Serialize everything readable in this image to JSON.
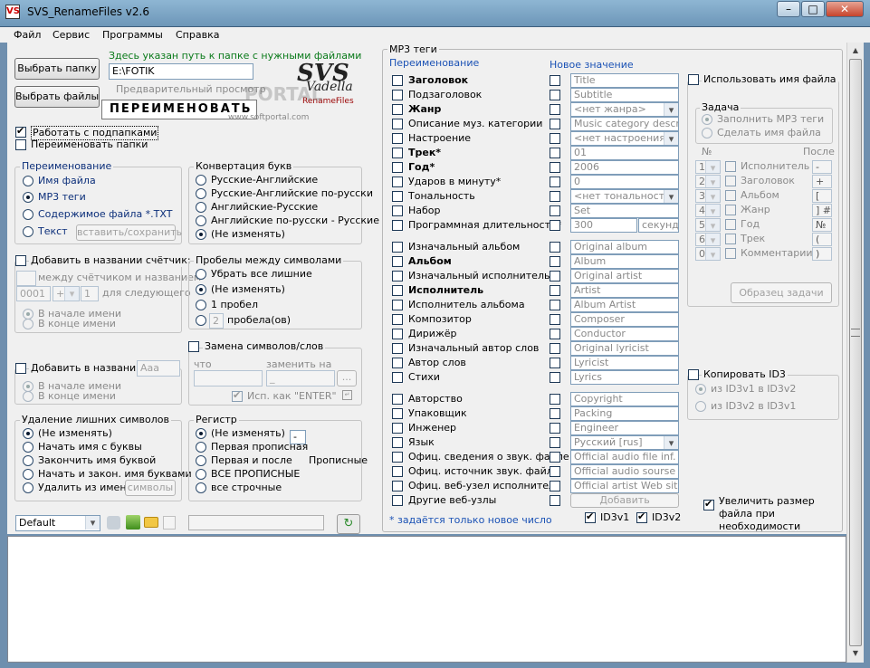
{
  "window": {
    "title": "SVS_RenameFiles v2.6",
    "icon": "app-icon",
    "controls": [
      "minimize-icon",
      "maximize-icon",
      "close-icon"
    ]
  },
  "menu": [
    "Файл",
    "Сервис",
    "Программы",
    "Справка"
  ],
  "left": {
    "select_folder": "Выбрать папку",
    "select_files": "Выбрать файлы",
    "path_hint": "Здесь указан путь к папке с нужными файлами",
    "path_value": "E:\\FOTIK",
    "preview_label": "Предварительный просмотр",
    "rename_button": "ПЕРЕИМЕНОВАТЬ",
    "logo_text": "SVS",
    "logo_sub": "Vadella",
    "logo_tag": "RenameFiles",
    "watermark": "PORTAL",
    "watermark_url": "www.softportal.com",
    "work_subfolders": "Работать с подпапками",
    "rename_folders": "Переименовать папки"
  },
  "rename_group": {
    "title": "Переименование",
    "items": [
      "Имя файла",
      "MP3 теги",
      "Содержимое файла *.TXT",
      "Текст"
    ],
    "insert_save": "вставить/сохранить"
  },
  "convert_group": {
    "title": "Конвертация букв",
    "items": [
      "Русские-Английские",
      "Русские-Английские по-русски",
      "Английские-Русские",
      "Английские по-русски - Русские",
      "(Не изменять)"
    ]
  },
  "counter_group": {
    "title": "Добавить в названии счётчик:",
    "between": "между счётчиком и названием",
    "start": "0001",
    "plus": "+",
    "step": "1",
    "next": "для следующего",
    "at_start": "В начале имени",
    "at_end": "В конце имени"
  },
  "spaces_group": {
    "title": "Пробелы между символами",
    "items": [
      "Убрать все лишние",
      "(Не изменять)",
      "1 пробел"
    ],
    "n_value": "2",
    "n_label": "пробела(ов)"
  },
  "replace_group": {
    "title": "Замена символов/слов",
    "what": "что",
    "replace_to": "заменить на",
    "replace_value": "_",
    "browse": "...",
    "as_enter": "Исп. как \"ENTER\""
  },
  "add_group": {
    "title": "Добавить в названии:",
    "value": "Aaa",
    "at_start": "В начале имени",
    "at_end": "В конце имени"
  },
  "remove_group": {
    "title": "Удаление лишних символов",
    "items": [
      "(Не изменять)",
      "Начать имя с буквы",
      "Закончить имя буквой",
      "Начать и закон. имя буквами",
      "Удалить из имени"
    ],
    "symbols_btn": "символы"
  },
  "case_group": {
    "title": "Регистр",
    "items": [
      "(Не изменять)",
      "Первая прописная",
      "Первая и после",
      "ВСЕ ПРОПИСНЫЕ",
      "все строчные"
    ],
    "after_value": "-",
    "upper_label": "Прописные"
  },
  "bottom_bar": {
    "preset": "Default"
  },
  "mp3": {
    "title": "MP3 теги",
    "rename_header": "Переименование",
    "new_value_header": "Новое значение",
    "rows": [
      {
        "label": "Заголовок",
        "bold": true,
        "value": "Title",
        "kind": "text"
      },
      {
        "label": "Подзаголовок",
        "bold": false,
        "value": "Subtitle",
        "kind": "text"
      },
      {
        "label": "Жанр",
        "bold": true,
        "value": "<нет жанра>",
        "kind": "dropdown"
      },
      {
        "label": "Описание муз. категории",
        "bold": false,
        "value": "Music category descripti",
        "kind": "text"
      },
      {
        "label": "Настроение",
        "bold": false,
        "value": "<нет настроения>",
        "kind": "dropdown"
      },
      {
        "label": "Трек*",
        "bold": true,
        "value": "01",
        "kind": "text"
      },
      {
        "label": "Год*",
        "bold": true,
        "value": "2006",
        "kind": "text"
      },
      {
        "label": "Ударов в минуту*",
        "bold": false,
        "value": "0",
        "kind": "text"
      },
      {
        "label": "Тональность",
        "bold": false,
        "value": "<нет тональности>",
        "kind": "dropdown"
      },
      {
        "label": "Набор",
        "bold": false,
        "value": "Set",
        "kind": "text"
      },
      {
        "label": "Программная длительность*",
        "bold": false,
        "value": "300",
        "kind": "duration"
      },
      {
        "label": "Изначальный альбом",
        "bold": false,
        "value": "Original album",
        "kind": "text"
      },
      {
        "label": "Альбом",
        "bold": true,
        "value": "Album",
        "kind": "text"
      },
      {
        "label": "Изначальный исполнитель",
        "bold": false,
        "value": "Original artist",
        "kind": "text"
      },
      {
        "label": "Исполнитель",
        "bold": true,
        "value": "Artist",
        "kind": "text"
      },
      {
        "label": "Исполнитель альбома",
        "bold": false,
        "value": "Album Artist",
        "kind": "text"
      },
      {
        "label": "Композитор",
        "bold": false,
        "value": "Composer",
        "kind": "text"
      },
      {
        "label": "Дирижёр",
        "bold": false,
        "value": "Conductor",
        "kind": "text"
      },
      {
        "label": "Изначальный автор слов",
        "bold": false,
        "value": "Original lyricist",
        "kind": "text"
      },
      {
        "label": "Автор слов",
        "bold": false,
        "value": "Lyricist",
        "kind": "text"
      },
      {
        "label": "Стихи",
        "bold": false,
        "value": "Lyrics",
        "kind": "text"
      },
      {
        "label": "Авторство",
        "bold": false,
        "value": "Copyright",
        "kind": "text"
      },
      {
        "label": "Упаковщик",
        "bold": false,
        "value": "Packing",
        "kind": "text"
      },
      {
        "label": "Инженер",
        "bold": false,
        "value": "Engineer",
        "kind": "text"
      },
      {
        "label": "Язык",
        "bold": false,
        "value": "Русский [rus]",
        "kind": "dropdown"
      },
      {
        "label": "Офиц. сведения о звук. файле",
        "bold": false,
        "value": "Official audio file inf.",
        "kind": "text"
      },
      {
        "label": "Офиц. источник звук. файла",
        "bold": false,
        "value": "Official audio sourse",
        "kind": "text"
      },
      {
        "label": "Офиц. веб-узел исполнителя",
        "bold": false,
        "value": "Official artist Web site",
        "kind": "text"
      },
      {
        "label": "Другие веб-узлы",
        "bold": false,
        "value": "",
        "kind": "add"
      }
    ],
    "seconds": "секунд",
    "add_button": "Добавить",
    "footnote": "* задаётся только новое число",
    "id3v1": "ID3v1",
    "id3v2": "ID3v2"
  },
  "filename_panel": {
    "use_filename": "Использовать имя файла",
    "task": "Задача",
    "fill_tags": "Заполнить MP3 теги",
    "make_name": "Сделать имя файла",
    "num_label": "№",
    "after_label": "После",
    "rows": [
      {
        "num": "1",
        "label": "Исполнитель",
        "after": "-"
      },
      {
        "num": "2",
        "label": "Заголовок",
        "after": "+"
      },
      {
        "num": "3",
        "label": "Альбом",
        "after": "["
      },
      {
        "num": "4",
        "label": "Жанр",
        "after": "] #"
      },
      {
        "num": "5",
        "label": "Год",
        "after": "№"
      },
      {
        "num": "6",
        "label": "Трек",
        "after": "("
      },
      {
        "num": "0",
        "label": "Комментарии",
        "after": ")"
      }
    ],
    "sample_button": "Образец задачи",
    "copy_id3": "Копировать ID3",
    "v1_to_v2": "из ID3v1 в ID3v2",
    "v2_to_v1": "из ID3v2 в ID3v1",
    "increase_size": "Увеличить размер файла при необходимости"
  }
}
